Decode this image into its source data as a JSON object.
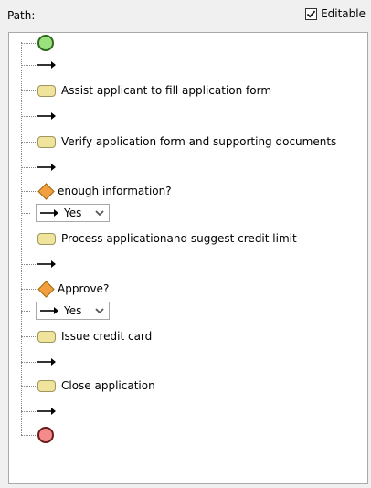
{
  "header": {
    "path_label": "Path:",
    "editable_label": "Editable",
    "editable_checked": true
  },
  "tree": {
    "items": [
      {
        "type": "start"
      },
      {
        "type": "arrow"
      },
      {
        "type": "activity",
        "label": "Assist applicant to fill application form"
      },
      {
        "type": "arrow"
      },
      {
        "type": "activity",
        "label": "Verify application form and supporting documents"
      },
      {
        "type": "arrow"
      },
      {
        "type": "decision",
        "label": "enough information?"
      },
      {
        "type": "branch",
        "value": "Yes"
      },
      {
        "type": "activity",
        "label": "Process applicationand suggest credit limit"
      },
      {
        "type": "arrow"
      },
      {
        "type": "decision",
        "label": "Approve?"
      },
      {
        "type": "branch",
        "value": "Yes"
      },
      {
        "type": "activity",
        "label": "Issue credit card"
      },
      {
        "type": "arrow"
      },
      {
        "type": "activity",
        "label": "Close application"
      },
      {
        "type": "arrow"
      },
      {
        "type": "end"
      }
    ]
  },
  "colors": {
    "start_fill": "#9ae07d",
    "end_fill": "#f48b8b",
    "activity_fill": "#f0e39b",
    "decision_fill": "#f1a040"
  }
}
